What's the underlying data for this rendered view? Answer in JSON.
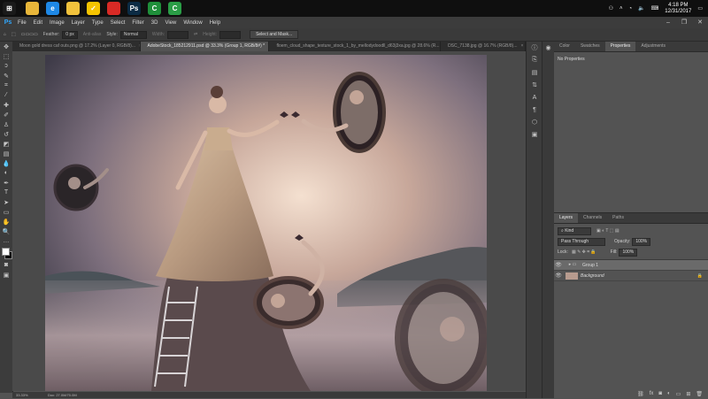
{
  "taskbar": {
    "apps": [
      {
        "name": "chrome-icon",
        "glyph": "",
        "color": "#e8b63a"
      },
      {
        "name": "edge-icon",
        "glyph": "e",
        "color": "#1e88e5"
      },
      {
        "name": "file-explorer-icon",
        "glyph": "",
        "color": "#f2c23c"
      },
      {
        "name": "norton-icon",
        "glyph": "✓",
        "color": "#f6c400"
      },
      {
        "name": "app-red-icon",
        "glyph": "",
        "color": "#d92a25"
      },
      {
        "name": "photoshop-icon",
        "glyph": "Ps",
        "color": "#0b2b44"
      },
      {
        "name": "camtasia-green-icon",
        "glyph": "C",
        "color": "#1f8f3a"
      },
      {
        "name": "camtasia-white-icon",
        "glyph": "C",
        "color": "#2a9d46"
      }
    ],
    "time": "4:18 PM",
    "date": "12/31/2017"
  },
  "menu": {
    "logo": "Ps",
    "items": [
      "File",
      "Edit",
      "Image",
      "Layer",
      "Type",
      "Select",
      "Filter",
      "3D",
      "View",
      "Window",
      "Help"
    ]
  },
  "options": {
    "feather_label": "Feather:",
    "feather_value": "0 px",
    "antialias": "Anti-alias",
    "style_label": "Style:",
    "style_value": "Normal",
    "width_label": "Width:",
    "height_label": "Height:",
    "select_mask": "Select and Mask..."
  },
  "tabs": [
    {
      "label": "Moon gold dress caf outs.png @ 17.2% (Layer 0, RGB/8)...",
      "active": false
    },
    {
      "label": "AdobeStock_185212911.psd @ 33.3% (Group 1, RGB/8#) *",
      "active": true
    },
    {
      "label": "floem_cloud_shape_texture_stock_1_by_mellodydoodll_d63j3xa.jpg @ 28.6% (R...",
      "active": false
    },
    {
      "label": "DSC_7138.jpg @ 16.7% (RGB/8)...",
      "active": false
    }
  ],
  "status": {
    "zoom": "33.33%",
    "doc": "Doc: 27.0M/70.0M"
  },
  "properties": {
    "tabs": [
      "Color",
      "Swatches",
      "Properties",
      "Adjustments"
    ],
    "active_tab": "Properties",
    "message": "No Properties"
  },
  "layers": {
    "tabs": [
      "Layers",
      "Channels",
      "Paths"
    ],
    "active_tab": "Layers",
    "filter_kind": "Kind",
    "blend_mode": "Pass Through",
    "opacity_label": "Opacity:",
    "opacity_value": "100%",
    "lock_label": "Lock:",
    "fill_label": "Fill:",
    "fill_value": "100%",
    "items": [
      {
        "name": "Group 1",
        "type": "group",
        "selected": true
      },
      {
        "name": "Background",
        "type": "layer",
        "selected": false
      }
    ]
  }
}
